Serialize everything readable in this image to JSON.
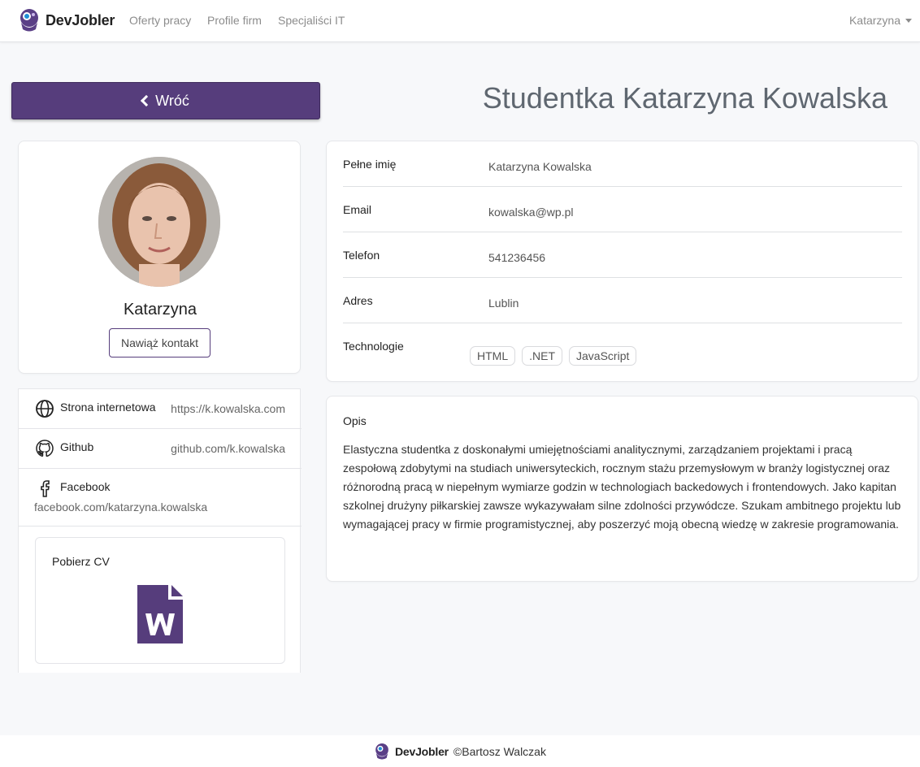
{
  "navbar": {
    "brand": "DevJobler",
    "links": [
      "Oferty pracy",
      "Profile firm",
      "Specjaliści IT"
    ],
    "user": "Katarzyna"
  },
  "back_button": "Wróć",
  "page_title": "Studentka Katarzyna Kowalska",
  "profile": {
    "name": "Katarzyna",
    "contact_button": "Nawiąż kontakt"
  },
  "links": {
    "website": {
      "label": "Strona internetowa",
      "value": "https://k.kowalska.com"
    },
    "github": {
      "label": "Github",
      "value": "github.com/k.kowalska"
    },
    "facebook": {
      "label": "Facebook",
      "value": "facebook.com/katarzyna.kowalska"
    },
    "cv_label": "Pobierz CV"
  },
  "info": {
    "full_name_label": "Pełne imię",
    "full_name": "Katarzyna Kowalska",
    "email_label": "Email",
    "email": "kowalska@wp.pl",
    "phone_label": "Telefon",
    "phone": "541236456",
    "address_label": "Adres",
    "address": "Lublin",
    "tech_label": "Technologie",
    "technologies": [
      "HTML",
      ".NET",
      "JavaScript"
    ]
  },
  "description": {
    "label": "Opis",
    "text": "Elastyczna studentka z doskonałymi umiejętnościami analitycznymi, zarządzaniem projektami i pracą zespołową zdobytymi na studiach uniwersyteckich, rocznym stażu przemysłowym w branży logistycznej oraz różnorodną pracą w niepełnym wymiarze godzin w technologiach backedowych i frontendowych. Jako kapitan szkolnej drużyny piłkarskiej zawsze wykazywałam silne zdolności przywódcze. Szukam ambitnego projektu lub wymagającej pracy w firmie programistycznej, aby poszerzyć moją obecną wiedzę w zakresie programowania."
  },
  "footer": {
    "brand": "DevJobler",
    "copyright": "©Bartosz Walczak"
  },
  "colors": {
    "accent": "#563d7c",
    "background": "#f7f8fa"
  }
}
